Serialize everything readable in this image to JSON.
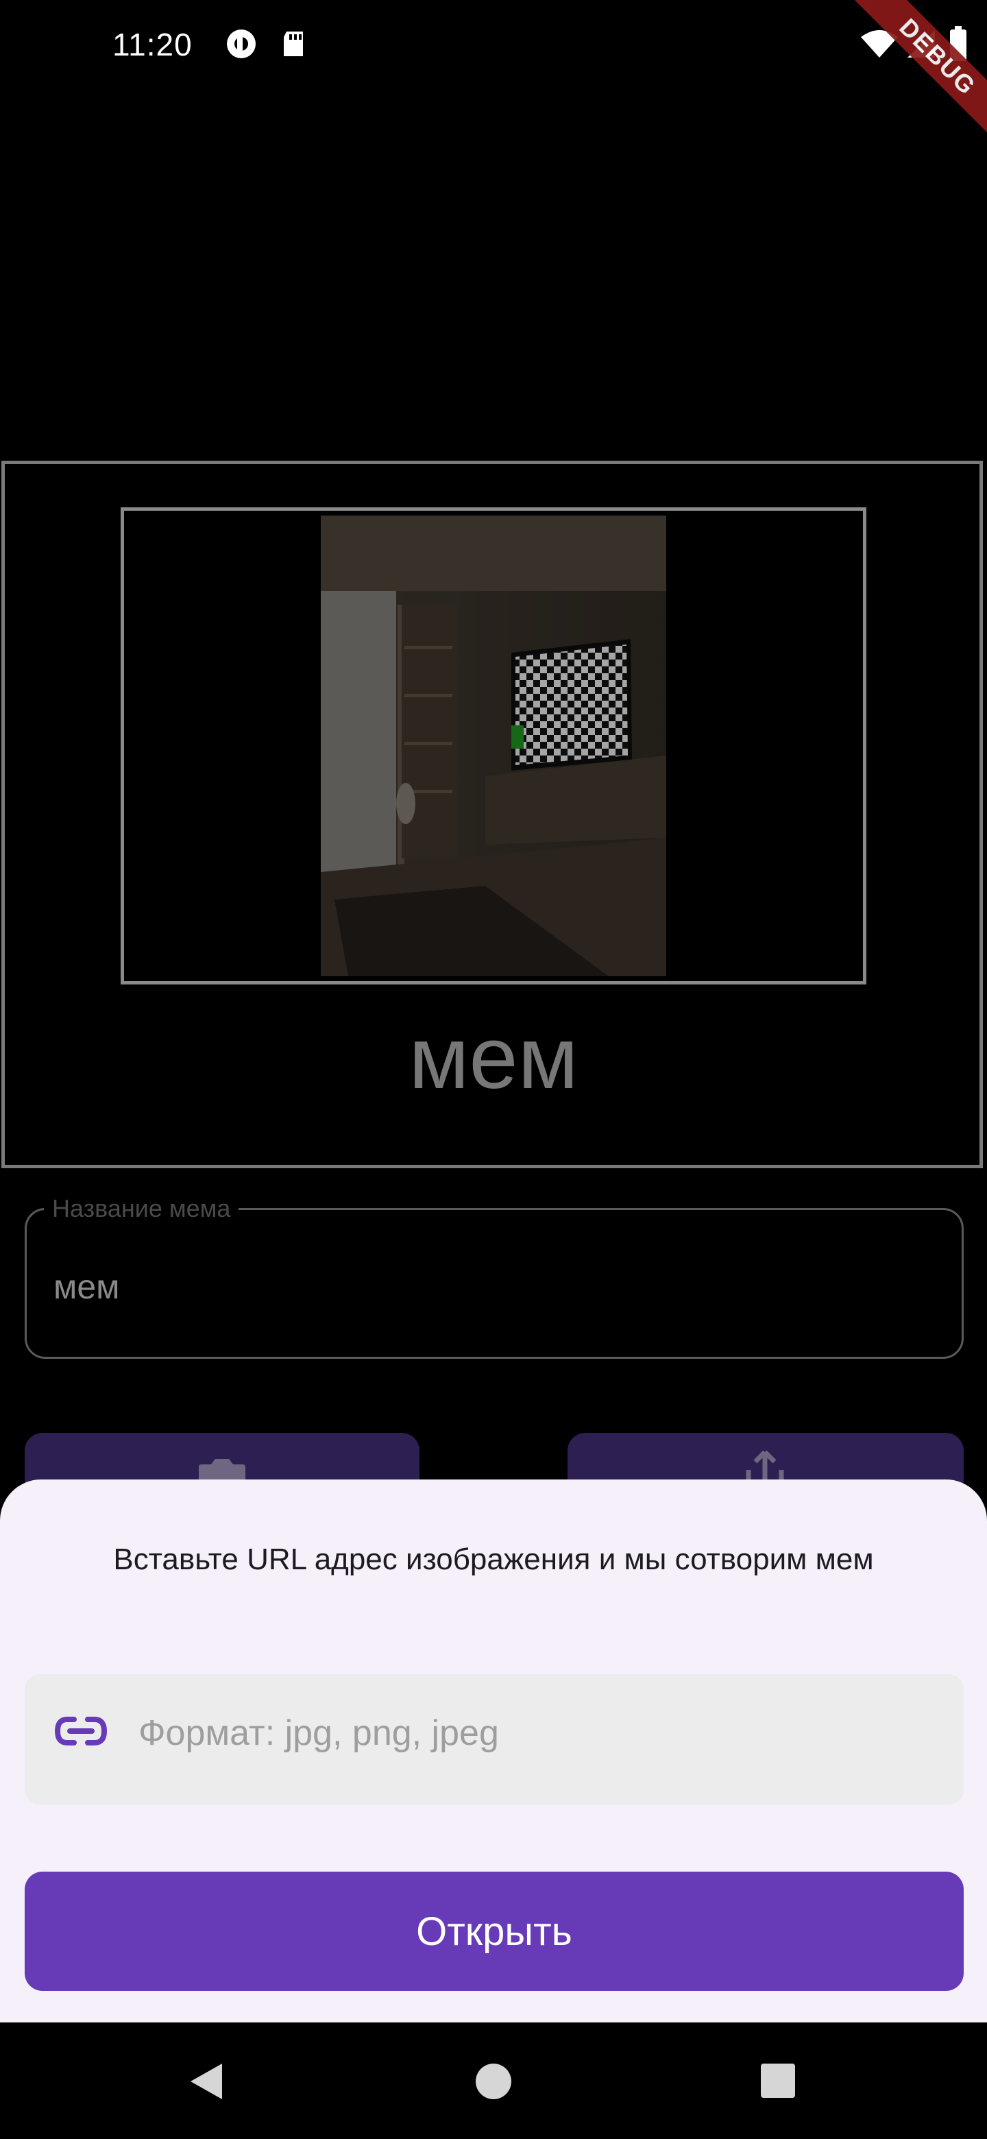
{
  "status_bar": {
    "time": "11:20",
    "debug_banner": "DEBUG"
  },
  "meme_preview": {
    "caption": "мем"
  },
  "name_field": {
    "label": "Название мема",
    "value": "мем"
  },
  "sheet": {
    "title": "Вставьте URL адрес изображения и мы сотворим мем",
    "url_placeholder": "Формат: jpg, png, jpeg",
    "open_button": "Открыть"
  },
  "colors": {
    "accent": "#673ab7",
    "sheet_bg": "#f5f0fa"
  },
  "icons": [
    "pocket-casts-icon",
    "sd-card-icon",
    "wifi-icon",
    "signal-icon",
    "battery-icon",
    "camera-icon",
    "share-icon",
    "link-icon",
    "back-icon",
    "home-icon",
    "recents-icon"
  ]
}
